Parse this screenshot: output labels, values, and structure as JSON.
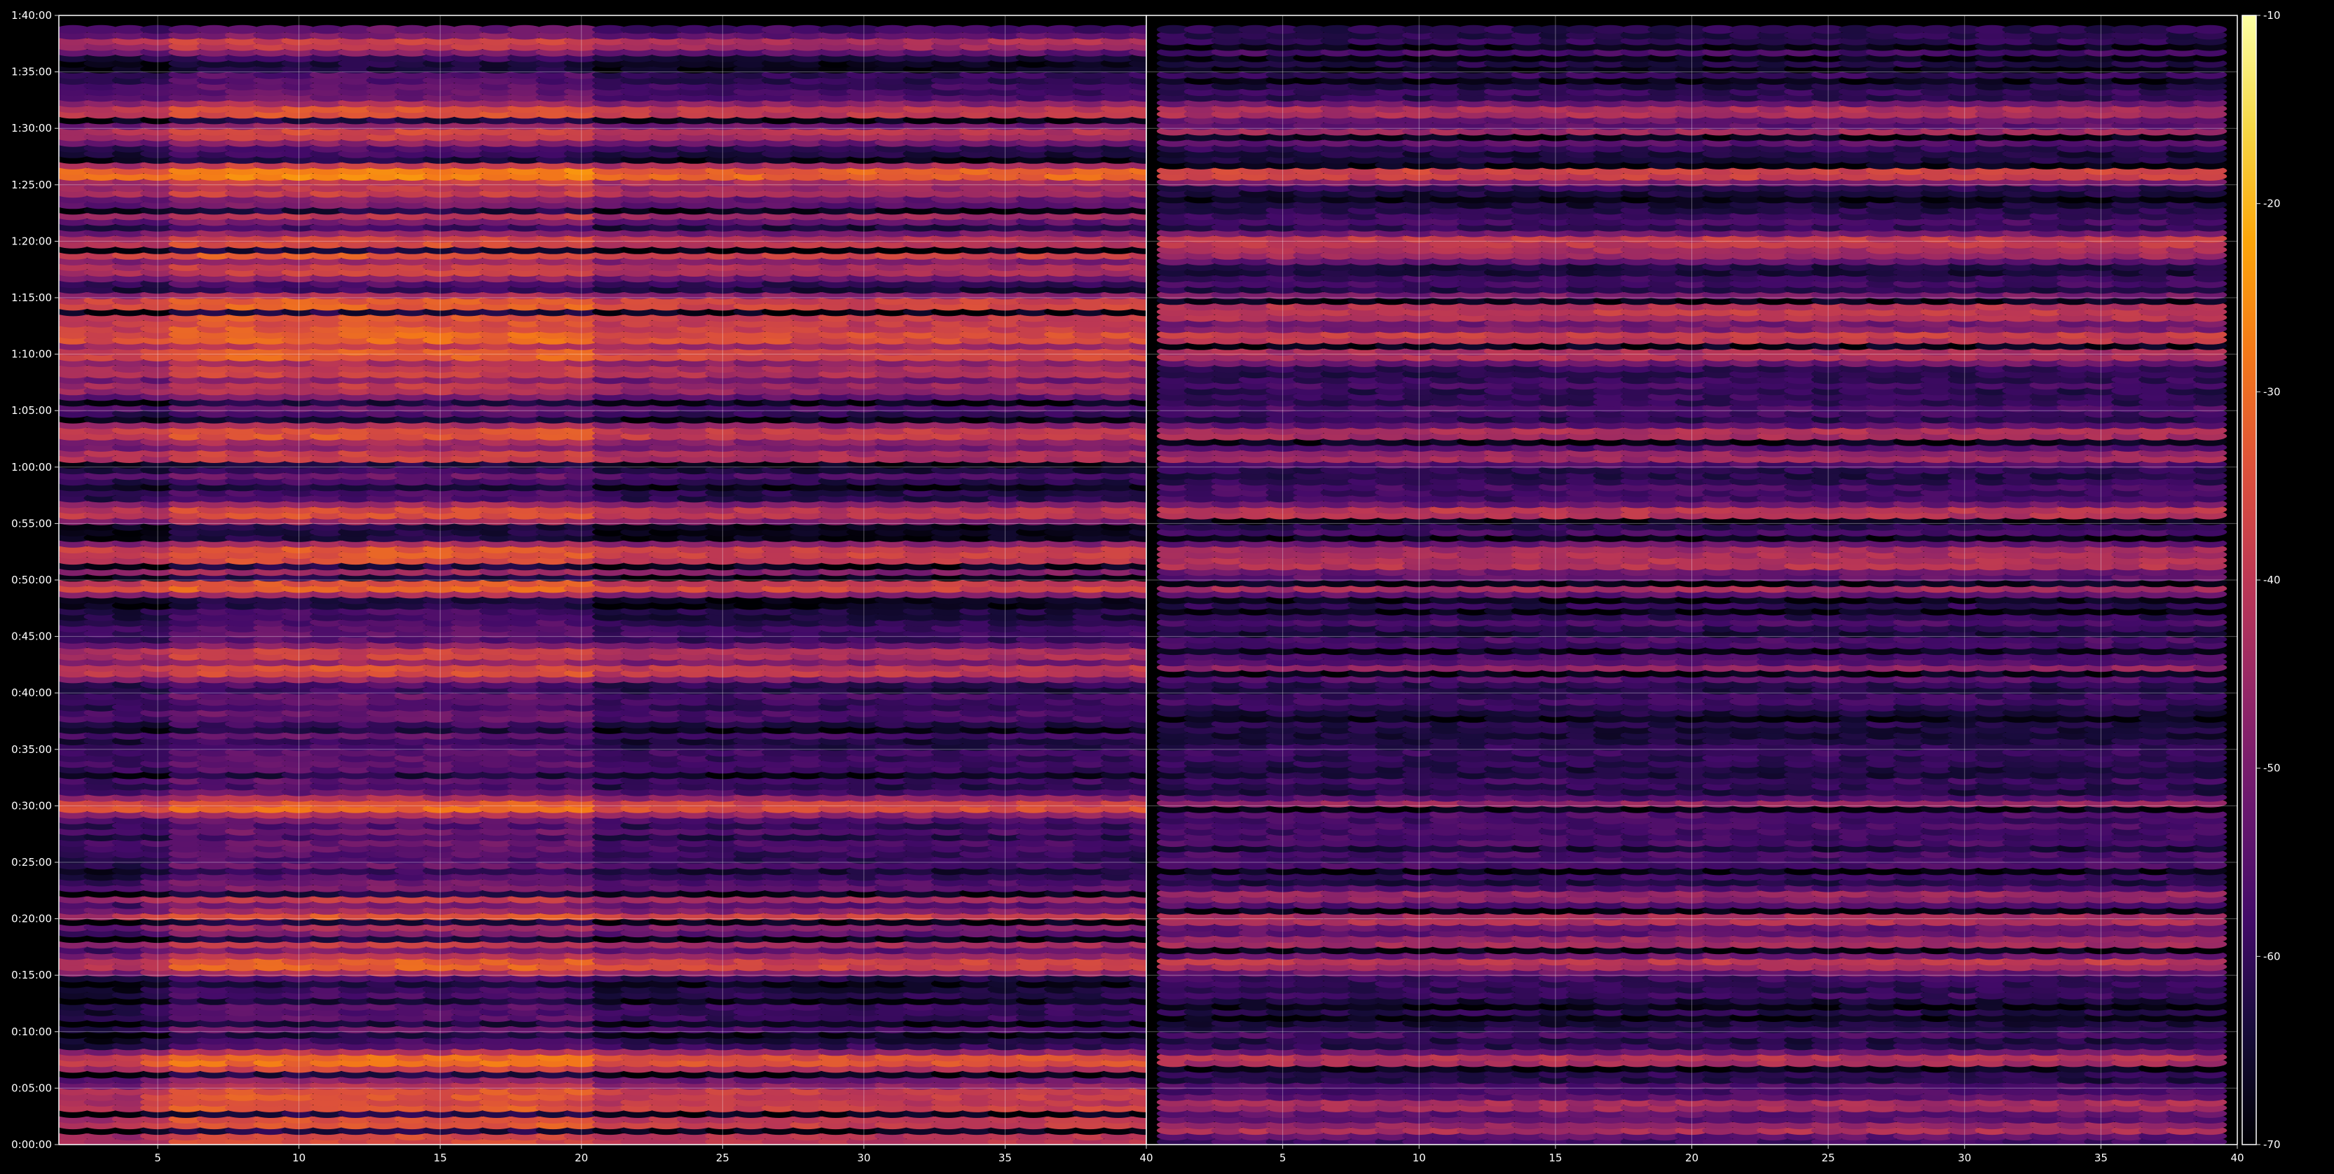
{
  "chart_data": {
    "type": "heatmap",
    "title": "",
    "xlabel": "",
    "ylabel": "",
    "background": "#000000",
    "colormap": "inferno",
    "grid": true,
    "legend": "none",
    "panels": [
      {
        "name": "",
        "xlim": [
          1.5,
          40
        ],
        "ylim": [
          "0:00:00",
          "1:40:00"
        ],
        "x_ticks": [
          "5",
          "10",
          "15",
          "20",
          "25",
          "30",
          "35",
          "40"
        ],
        "y_ticks": [
          "0:00:00",
          "0:05:00",
          "0:10:00",
          "0:15:00",
          "0:20:00",
          "0:25:00",
          "0:30:00",
          "0:35:00",
          "0:40:00",
          "0:45:00",
          "0:50:00",
          "0:55:00",
          "1:00:00",
          "1:05:00",
          "1:10:00",
          "1:15:00",
          "1:20:00",
          "1:25:00",
          "1:30:00",
          "1:35:00",
          "1:40:00"
        ],
        "columns": [
          2,
          40
        ],
        "bright_columns": [
          6,
          20
        ],
        "hot_rows": [
          {
            "time": "0:00:30",
            "value": -34
          },
          {
            "time": "0:01:30",
            "value": -33
          },
          {
            "time": "0:02:30",
            "value": -34
          },
          {
            "time": "0:03:30",
            "value": -33
          },
          {
            "time": "0:04:30",
            "value": -31
          },
          {
            "time": "0:06:30",
            "value": -36
          },
          {
            "time": "0:07:30",
            "value": -30
          },
          {
            "time": "0:16:00",
            "value": -30
          },
          {
            "time": "0:18:00",
            "value": -38
          },
          {
            "time": "0:20:00",
            "value": -33
          },
          {
            "time": "0:22:00",
            "value": -38
          },
          {
            "time": "0:30:00",
            "value": -31
          },
          {
            "time": "0:42:00",
            "value": -34
          },
          {
            "time": "0:43:30",
            "value": -37
          },
          {
            "time": "0:49:30",
            "value": -32
          },
          {
            "time": "0:51:30",
            "value": -33
          },
          {
            "time": "0:52:30",
            "value": -32
          },
          {
            "time": "0:56:00",
            "value": -33
          },
          {
            "time": "1:01:00",
            "value": -35
          },
          {
            "time": "1:03:00",
            "value": -32
          },
          {
            "time": "1:07:00",
            "value": -38
          },
          {
            "time": "1:08:30",
            "value": -36
          },
          {
            "time": "1:10:00",
            "value": -32
          },
          {
            "time": "1:11:30",
            "value": -29
          },
          {
            "time": "1:12:30",
            "value": -33
          },
          {
            "time": "1:13:30",
            "value": -31
          },
          {
            "time": "1:14:30",
            "value": -32
          },
          {
            "time": "1:17:30",
            "value": -36
          },
          {
            "time": "1:19:00",
            "value": -33
          },
          {
            "time": "1:20:00",
            "value": -35
          },
          {
            "time": "1:22:30",
            "value": -38
          },
          {
            "time": "1:24:30",
            "value": -37
          },
          {
            "time": "1:26:00",
            "value": -27
          },
          {
            "time": "1:29:30",
            "value": -36
          },
          {
            "time": "1:31:30",
            "value": -32
          },
          {
            "time": "1:37:30",
            "value": -38
          }
        ]
      },
      {
        "name": "",
        "xlim": [
          0,
          40
        ],
        "ylim": [
          "0:00:00",
          "1:40:00"
        ],
        "x_ticks": [
          "5",
          "10",
          "15",
          "20",
          "25",
          "30",
          "35",
          "40"
        ],
        "y_ticks": [],
        "columns": [
          1,
          39
        ],
        "bright_columns": [],
        "hot_rows": [
          {
            "time": "0:01:30",
            "value": -38
          },
          {
            "time": "0:03:30",
            "value": -38
          },
          {
            "time": "0:07:30",
            "value": -36
          },
          {
            "time": "0:16:00",
            "value": -36
          },
          {
            "time": "0:18:00",
            "value": -38
          },
          {
            "time": "0:20:00",
            "value": -37
          },
          {
            "time": "0:22:00",
            "value": -40
          },
          {
            "time": "0:30:00",
            "value": -40
          },
          {
            "time": "0:42:00",
            "value": -39
          },
          {
            "time": "0:49:30",
            "value": -38
          },
          {
            "time": "0:51:30",
            "value": -36
          },
          {
            "time": "0:52:30",
            "value": -37
          },
          {
            "time": "0:56:00",
            "value": -36
          },
          {
            "time": "1:01:00",
            "value": -40
          },
          {
            "time": "1:03:00",
            "value": -38
          },
          {
            "time": "1:10:00",
            "value": -36
          },
          {
            "time": "1:11:30",
            "value": -33
          },
          {
            "time": "1:13:30",
            "value": -35
          },
          {
            "time": "1:14:30",
            "value": -34
          },
          {
            "time": "1:19:00",
            "value": -37
          },
          {
            "time": "1:20:00",
            "value": -35
          },
          {
            "time": "1:26:00",
            "value": -33
          },
          {
            "time": "1:29:30",
            "value": -38
          },
          {
            "time": "1:31:30",
            "value": -36
          }
        ]
      }
    ],
    "colorbar": {
      "label": "",
      "range": [
        -70,
        -10
      ],
      "ticks": [
        "-10",
        "-20",
        "-30",
        "-40",
        "-50",
        "-60",
        "-70"
      ]
    }
  }
}
